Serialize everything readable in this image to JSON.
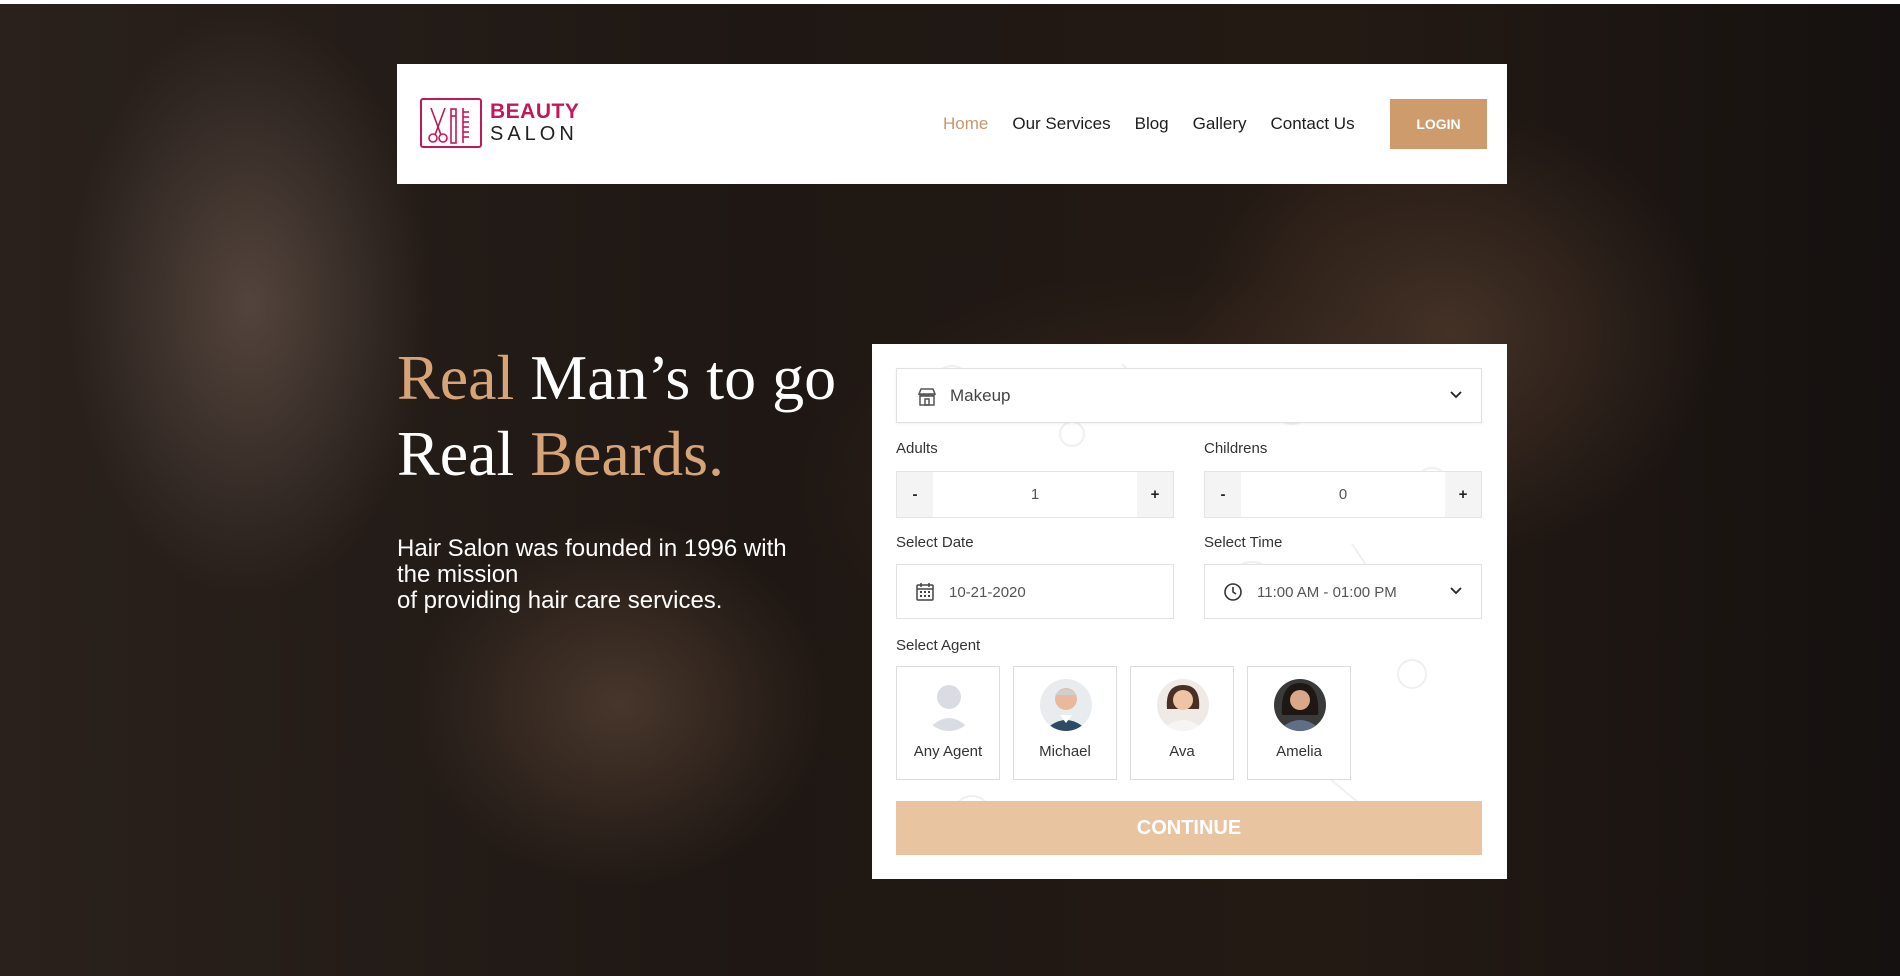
{
  "brand": {
    "line1": "BEAUTY",
    "line2": "SALON",
    "color": "#c2185b"
  },
  "nav": {
    "items": [
      {
        "label": "Home",
        "active": true
      },
      {
        "label": "Our Services",
        "active": false
      },
      {
        "label": "Blog",
        "active": false
      },
      {
        "label": "Gallery",
        "active": false
      },
      {
        "label": "Contact Us",
        "active": false
      }
    ],
    "login_label": "LOGIN"
  },
  "hero": {
    "line1_accent": "Real",
    "line1_rest": " Man’s to go",
    "line2_plain": "Real ",
    "line2_accent": "Beards.",
    "desc_line1": "Hair Salon was founded in 1996 with",
    "desc_line2": "the mission",
    "desc_line3": "of providing hair care services."
  },
  "form": {
    "service": {
      "value": "Makeup",
      "icon": "store-icon"
    },
    "adults": {
      "label": "Adults",
      "minus": "-",
      "plus": "+",
      "value": "1"
    },
    "childrens": {
      "label": "Childrens",
      "minus": "-",
      "plus": "+",
      "value": "0"
    },
    "date": {
      "label": "Select Date",
      "value": "10-21-2020",
      "icon": "calendar-icon"
    },
    "time": {
      "label": "Select Time",
      "value": "11:00 AM - 01:00 PM",
      "icon": "clock-icon"
    },
    "agent_label": "Select Agent",
    "agents": [
      {
        "name": "Any Agent"
      },
      {
        "name": "Michael"
      },
      {
        "name": "Ava"
      },
      {
        "name": "Amelia"
      }
    ],
    "continue_label": "CONTINUE"
  },
  "colors": {
    "accent": "#cd9b6c",
    "accent_light": "#e8c4a1",
    "brand": "#c2185b"
  }
}
